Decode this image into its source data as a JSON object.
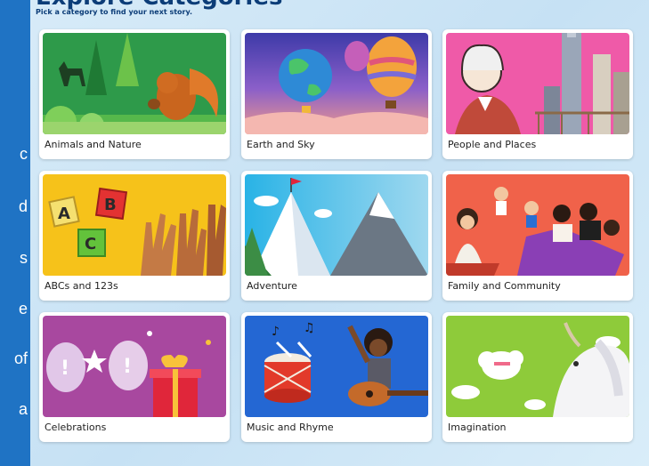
{
  "page": {
    "heading": "Explore Categories",
    "subtitle": "Pick a category to find your next story."
  },
  "sidebar": {
    "fragments": [
      "c",
      "d",
      "s",
      "e",
      "of",
      "a"
    ]
  },
  "categories": [
    {
      "label": "Animals and Nature",
      "icon": "squirrel-forest-illustration"
    },
    {
      "label": "Earth and Sky",
      "icon": "globe-balloons-illustration"
    },
    {
      "label": "People and Places",
      "icon": "city-skyline-illustration"
    },
    {
      "label": "ABCs and 123s",
      "icon": "alphabet-blocks-hands-illustration"
    },
    {
      "label": "Adventure",
      "icon": "mountain-flag-illustration"
    },
    {
      "label": "Family and Community",
      "icon": "family-picnic-illustration"
    },
    {
      "label": "Celebrations",
      "icon": "balloons-gift-illustration"
    },
    {
      "label": "Music and Rhyme",
      "icon": "drum-guitar-illustration"
    },
    {
      "label": "Imagination",
      "icon": "unicorn-clouds-illustration"
    }
  ],
  "colors": {
    "sidebar": "#1f73c4",
    "heading": "#0c3d78",
    "background": "#cfe6f6"
  }
}
